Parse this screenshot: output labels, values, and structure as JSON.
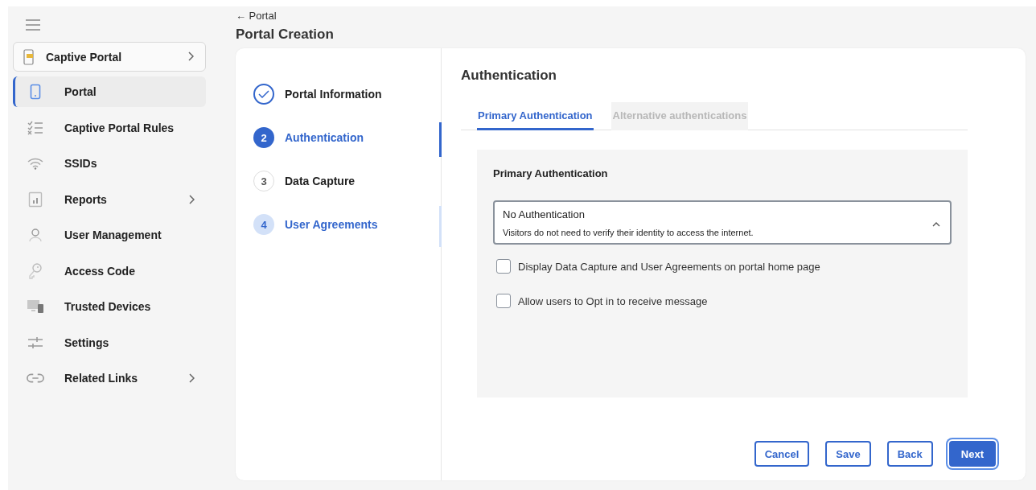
{
  "sidebar": {
    "header": {
      "label": "Captive Portal",
      "has_children": true
    },
    "items": [
      {
        "label": "Portal",
        "selected": true,
        "has_children": false
      },
      {
        "label": "Captive Portal Rules",
        "selected": false,
        "has_children": false
      },
      {
        "label": "SSIDs",
        "selected": false,
        "has_children": false
      },
      {
        "label": "Reports",
        "selected": false,
        "has_children": true
      },
      {
        "label": "User Management",
        "selected": false,
        "has_children": false
      },
      {
        "label": "Access Code",
        "selected": false,
        "has_children": false
      },
      {
        "label": "Trusted Devices",
        "selected": false,
        "has_children": false
      },
      {
        "label": "Settings",
        "selected": false,
        "has_children": false
      },
      {
        "label": "Related Links",
        "selected": false,
        "has_children": true
      }
    ]
  },
  "breadcrumb": {
    "back_label": "← Portal",
    "title": "Portal Creation"
  },
  "steps": [
    {
      "label": "Portal Information",
      "completed": true,
      "selected": false,
      "highlighted": false
    },
    {
      "number": "2",
      "label": "Authentication",
      "completed": false,
      "selected": true,
      "highlighted": false
    },
    {
      "number": "3",
      "label": "Data Capture",
      "completed": false,
      "selected": false,
      "highlighted": false
    },
    {
      "number": "4",
      "label": "User Agreements",
      "completed": false,
      "selected": false,
      "highlighted": true
    }
  ],
  "panel": {
    "title": "Authentication",
    "tabs": [
      {
        "label": "Primary Authentication",
        "selected": true,
        "disabled": false
      },
      {
        "label": "Alternative authentications",
        "selected": false,
        "disabled": true
      }
    ],
    "section_title": "Primary Authentication",
    "dropdown": {
      "value": "No Authentication",
      "description": "Visitors do not need to verify their identity to access the internet.",
      "expanded": true
    },
    "options": [
      {
        "label": "Display Data Capture and User Agreements on portal home page",
        "checked": false
      },
      {
        "label": "Allow users to Opt in to receive message",
        "checked": false
      }
    ]
  },
  "buttons": [
    {
      "label": "Cancel",
      "kind": "secondary"
    },
    {
      "label": "Save",
      "kind": "secondary"
    },
    {
      "label": "Back",
      "kind": "secondary"
    },
    {
      "label": "Next",
      "kind": "primary"
    }
  ]
}
